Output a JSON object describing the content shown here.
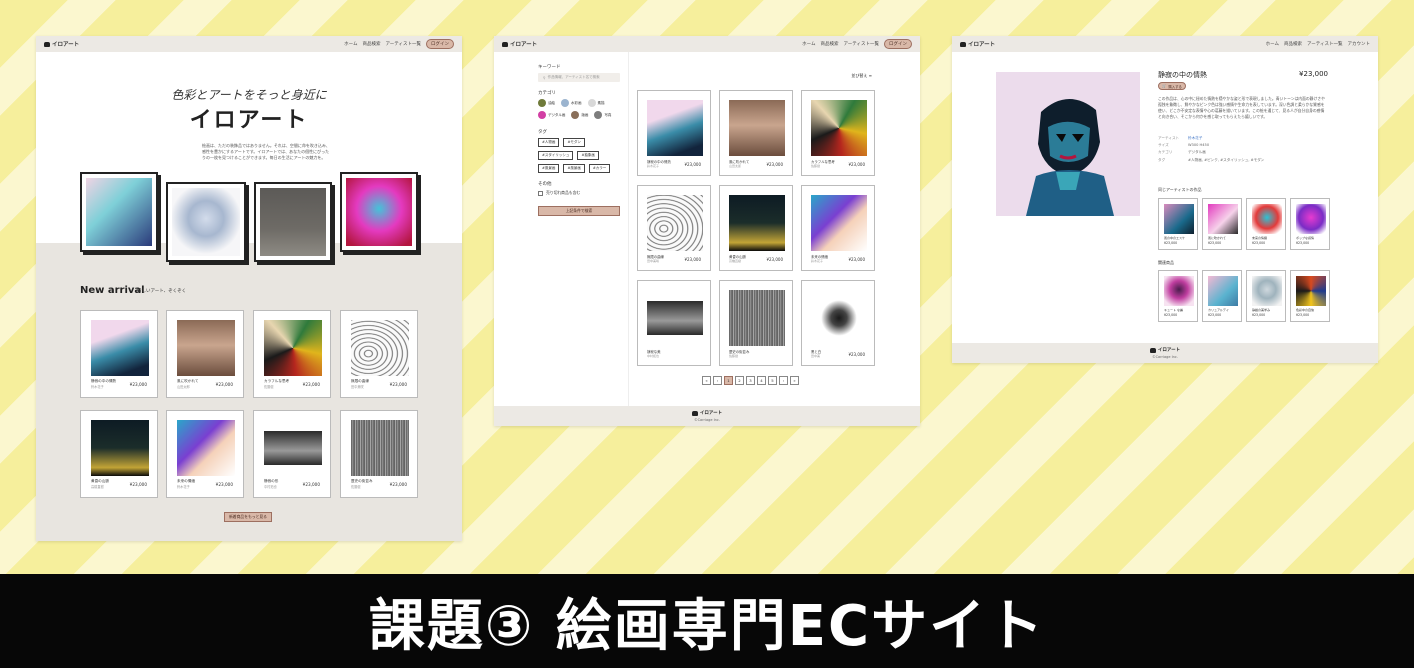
{
  "colors": {
    "accent_button": "#d9b8a8",
    "accent_border": "#9d6f60",
    "nav_bg": "#ece9e4",
    "background_stripe_1": "#f6ef9c",
    "background_stripe_2": "#fbf7cf",
    "bottom_bar": "#070707",
    "link_blue": "#4a7cc9"
  },
  "caption": "課題③ 絵画専門ECサイト",
  "brand": "イロアート",
  "shot1": {
    "nav": [
      "ホーム",
      "商品検索",
      "アーティスト一覧"
    ],
    "login": "ログイン",
    "hero_script": "色彩とアートをそっと身近に",
    "hero_title": "イロアート",
    "hero_desc": "絵画は、ただの装飾品ではありません。それは、空間に命を吹き込み、感性を豊かにするアートです。イロアートでは、あなたの個性にぴったりの一枚を見つけることができます。毎日の生活にアートの魅力を。",
    "new_arrival": "New arrival",
    "new_arrival_sub": "新しいアート、ぞくぞく",
    "products": [
      {
        "name": "静寂の中の情熱",
        "artist": "鈴木花子",
        "price": "¥23,000"
      },
      {
        "name": "風に吹かれて",
        "artist": "山田太郎",
        "price": "¥23,000"
      },
      {
        "name": "カラフルな思考",
        "artist": "佐藤健",
        "price": "¥23,000"
      },
      {
        "name": "無限の曲線",
        "artist": "田中美咲",
        "price": "¥23,000"
      },
      {
        "name": "黄昏の山脈",
        "artist": "高橋直樹",
        "price": "¥23,000"
      },
      {
        "name": "未来の情緒",
        "artist": "鈴木花子",
        "price": "¥23,000"
      },
      {
        "name": "静寂の形",
        "artist": "中村拓也",
        "price": "¥23,000"
      },
      {
        "name": "歴史の街並み",
        "artist": "佐藤健",
        "price": "¥23,000"
      }
    ],
    "more_button": "新着商品をもっと見る"
  },
  "shot2": {
    "nav": [
      "ホーム",
      "商品検索",
      "アーティスト一覧"
    ],
    "login": "ログイン",
    "keyword_label": "キーワード",
    "keyword_placeholder": "作品情報、アーティスト名で検索",
    "category_label": "カテゴリ",
    "categories": [
      "油絵",
      "水彩画",
      "素描",
      "デジタル画",
      "版画",
      "写真"
    ],
    "tag_label": "タグ",
    "tags": [
      "#人物画",
      "#モダン",
      "#スタイリッシュ",
      "#抽象画",
      "#風景画",
      "#風景画",
      "#カラー"
    ],
    "other_label": "その他",
    "sold_out_label": "売り切れ商品も含む",
    "search_button": "上記条件で検索",
    "sort": "並び替え",
    "products": [
      {
        "name": "静寂の中の情熱",
        "artist": "鈴木花子",
        "price": "¥23,000"
      },
      {
        "name": "風に吹かれて",
        "artist": "山田太郎",
        "price": "¥23,000"
      },
      {
        "name": "カラフルな思考",
        "artist": "佐藤健",
        "price": "¥23,000"
      },
      {
        "name": "無限の曲線",
        "artist": "田中美咲",
        "price": "¥23,000"
      },
      {
        "name": "黄昏の山脈",
        "artist": "高橋直樹",
        "price": "¥23,000"
      },
      {
        "name": "未来の情緒",
        "artist": "鈴木花子",
        "price": "¥23,000"
      },
      {
        "name": "静寂な美",
        "artist": "中村拓也",
        "price": ""
      },
      {
        "name": "歴史の街並み",
        "artist": "佐藤健",
        "price": ""
      },
      {
        "name": "黒と白",
        "artist": "田中美",
        "price": "¥23,000"
      }
    ],
    "pager": [
      "«",
      "‹",
      "1",
      "2",
      "3",
      "4",
      "5",
      "›",
      "»"
    ],
    "copyright": "©Carriage Inc."
  },
  "shot3": {
    "nav": [
      "ホーム",
      "商品検索",
      "アーティスト一覧",
      "アカウント"
    ],
    "title": "静寂の中の情熱",
    "price": "¥23,000",
    "cart_button": "購入する",
    "description": "この作品は、心の中に秘めた情熱を穏やかな姿と形で表現しました。青いトーンは内面の静けさや孤独を象徴し、鮮やかなピンク色は強い感情や生命力を表しています。深い色調と柔らかな質感を使い、どこか不安定な表情や心の葛藤を描いています。この絵を通じて、見る人が自分自身の感情と向き合い、そこから何かを感じ取ってもらえたら嬉しいです。",
    "specs": [
      {
        "key": "アーティスト",
        "value": "鈴木花子"
      },
      {
        "key": "サイズ",
        "value": "W300 H450"
      },
      {
        "key": "カテゴリ",
        "value": "デジタル画"
      },
      {
        "key": "タグ",
        "value": "#人物画, #ピンク, #スタイリッシュ, #モダン"
      }
    ],
    "same_artist_heading": "同じアーティストの作品",
    "same_artist": [
      {
        "name": "風の中のエスケ",
        "price": "¥23,000"
      },
      {
        "name": "風に吹かれて",
        "price": "¥23,000"
      },
      {
        "name": "未来の情緒",
        "price": "¥23,000"
      },
      {
        "name": "ポップな感情",
        "price": "¥23,000"
      }
    ],
    "related_heading": "関連商品",
    "related": [
      {
        "name": "キュート な麗",
        "price": "¥23,000"
      },
      {
        "name": "カリュアルデイ",
        "price": "¥23,000"
      },
      {
        "name": "静謐の美学み",
        "price": "¥23,000"
      },
      {
        "name": "色彩中の自信",
        "price": "¥23,000"
      }
    ],
    "copyright": "©Carriage Inc."
  }
}
